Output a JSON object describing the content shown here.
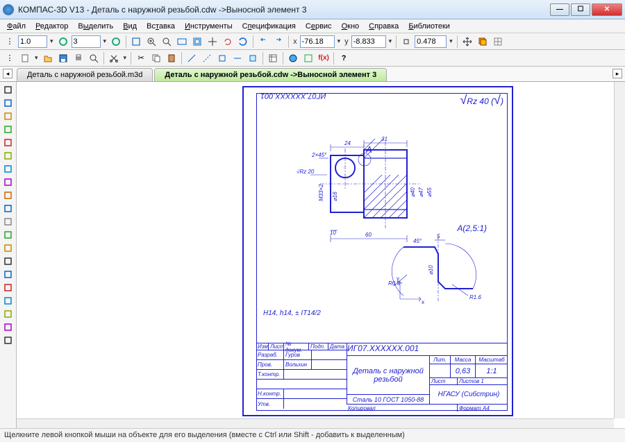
{
  "title": "КОМПАС-3D V13 - Деталь с наружной резьбой.cdw ->Выносной элемент 3",
  "menu": [
    "Файл",
    "Редактор",
    "Выделить",
    "Вид",
    "Вставка",
    "Инструменты",
    "Спецификация",
    "Сервис",
    "Окно",
    "Справка",
    "Библиотеки"
  ],
  "menu_underline_idx": [
    0,
    0,
    1,
    0,
    2,
    0,
    1,
    1,
    0,
    0,
    0
  ],
  "toolbar1": {
    "zoom": "1.0",
    "state": "3",
    "x_label": "x",
    "x": "-76.18",
    "y_label": "y",
    "y": "-8.833",
    "scale": "0.478"
  },
  "tabs": {
    "t1": "Деталь с наружной резьбой.m3d",
    "t2": "Деталь с наружной резьбой.cdw ->Выносной элемент 3"
  },
  "drawing": {
    "code_rot": "ИГ07.XXXXXX.001",
    "surface": "Rz 40",
    "section_label": "А",
    "dims": {
      "d24": "24",
      "d31": "31",
      "chamfer": "2×45°",
      "rz20": "Rz 20",
      "thread": "М33×2",
      "d16": "⌀16",
      "d40": "⌀40",
      "d47": "⌀47",
      "d55": "⌀55",
      "d10": "10",
      "d60": "60"
    },
    "detail": {
      "label": "А(2,5:1)",
      "a45": "45°",
      "d5": "5",
      "d10": "⌀10",
      "r05": "R0.5",
      "r16": "R1.6"
    },
    "tolerance": "H14, h14, ± IT14/2"
  },
  "titleblock": {
    "designation": "ИГ07.XXXXXX.001",
    "name": "Деталь с наружной резьбой",
    "material": "Сталь 10 ГОСТ 1050-88",
    "mass": "0,63",
    "scale": "1:1",
    "org": "НГАСУ (Сибстрин)",
    "sheet": "Лист",
    "sheets": "Листов 1",
    "lit": "Лит.",
    "mass_h": "Масса",
    "scale_h": "Масштаб",
    "format": "Формат   А4",
    "copied": "Копировал",
    "dev": "Разраб.",
    "chk": "Пров.",
    "tctrl": "Т.контр.",
    "nctrl": "Н.контр.",
    "appr": "Утв.",
    "name1": "Гуров",
    "name2": "Вольхин",
    "hdr_izm": "Изм.",
    "hdr_list": "Лист",
    "hdr_doc": "№ докум.",
    "hdr_sign": "Подп.",
    "hdr_date": "Дата"
  },
  "status": "Щелкните левой кнопкой мыши на объекте для его выделения (вместе с Ctrl или Shift - добавить к выделенным)"
}
